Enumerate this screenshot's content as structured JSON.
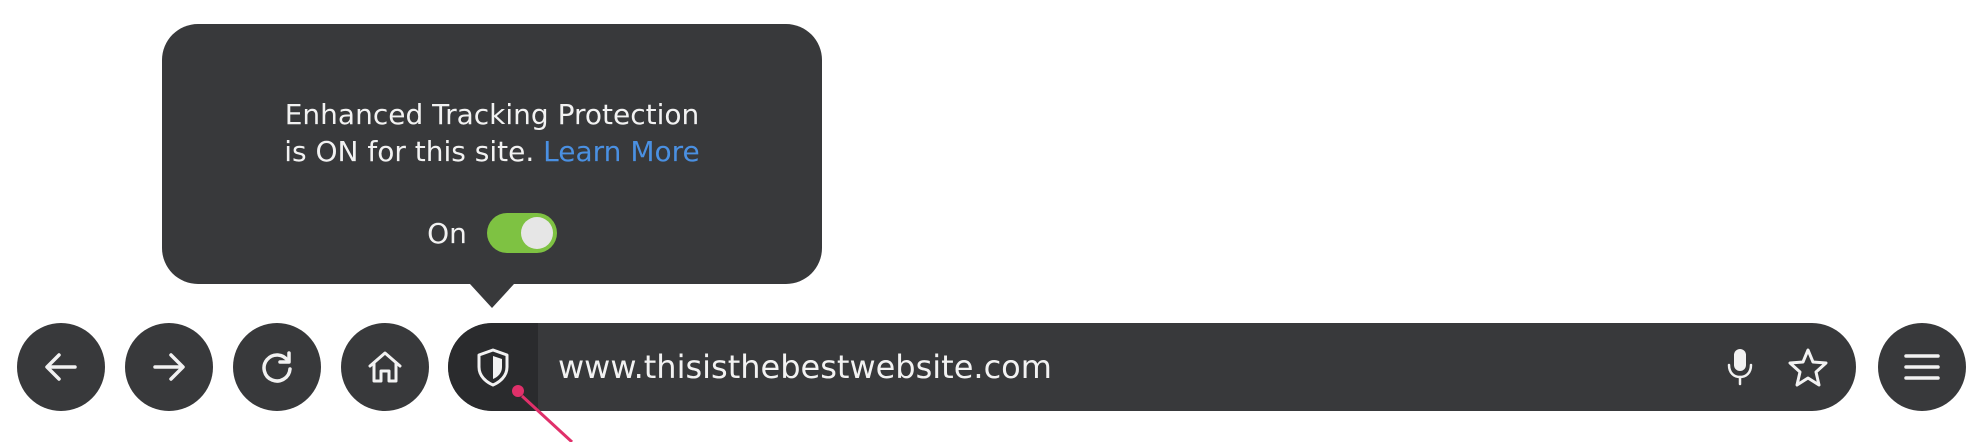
{
  "popup": {
    "line1": "Enhanced Tracking Protection",
    "line2_prefix": "is ON for this site.",
    "learn_more": "Learn More",
    "toggle_label": "On",
    "toggle_state": "on"
  },
  "toolbar": {
    "back_icon": "arrow-left-icon",
    "forward_icon": "arrow-right-icon",
    "reload_icon": "reload-icon",
    "home_icon": "home-icon",
    "shield_icon": "shield-icon",
    "url": "www.thisisthebestwebsite.com",
    "mic_icon": "microphone-icon",
    "star_icon": "star-icon",
    "menu_icon": "hamburger-menu-icon"
  },
  "colors": {
    "bar_bg": "#38393b",
    "shield_bg": "#2a2b2d",
    "link": "#4a90e2",
    "toggle_on": "#7ec242",
    "pointer": "#e0306a"
  }
}
